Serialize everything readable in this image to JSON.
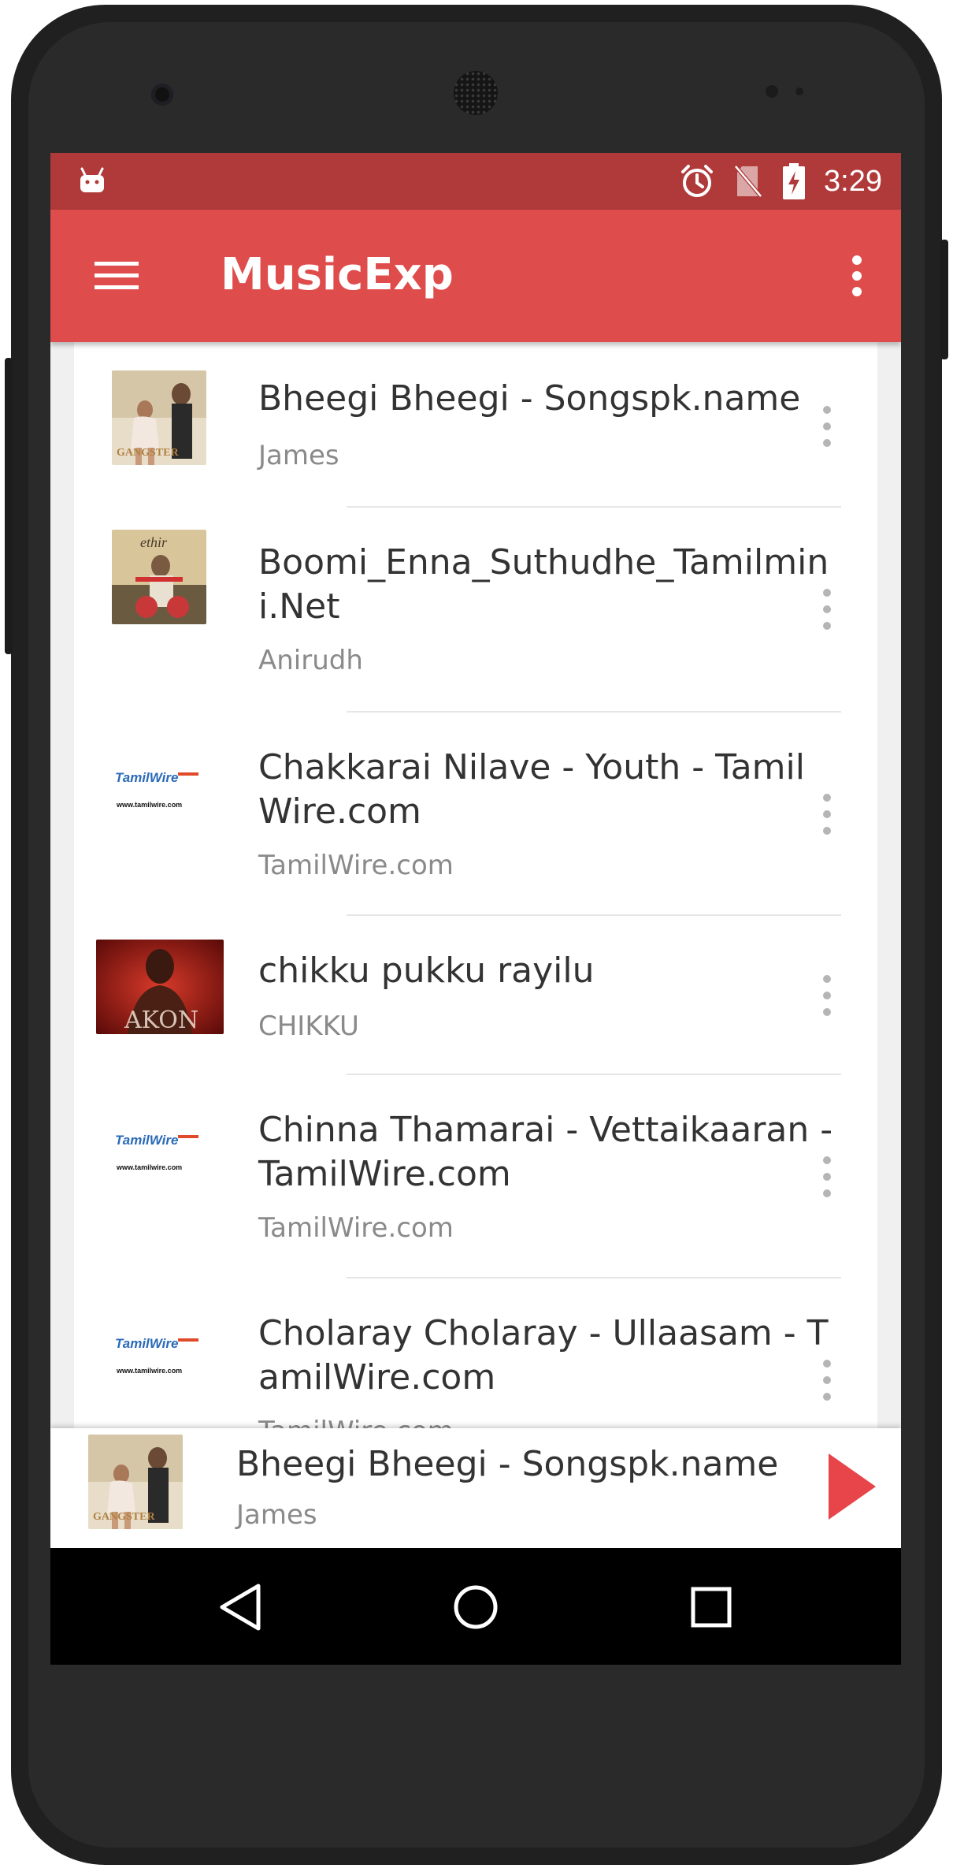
{
  "status_bar": {
    "time": "3:29",
    "icons": [
      "android-debug-icon",
      "alarm-icon",
      "no-sim-icon",
      "battery-charging-icon"
    ]
  },
  "app_bar": {
    "title": "MusicExp",
    "menu_icon": "hamburger-menu-icon",
    "overflow_icon": "more-vert-icon"
  },
  "songs": [
    {
      "title": "Bheegi Bheegi - Songspk.name",
      "artist": "James",
      "art": "gangster-album-art"
    },
    {
      "title": "Boomi_Enna_Suthudhe_Tamilmini.Net",
      "artist": "Anirudh",
      "art": "ethir-neechal-album-art"
    },
    {
      "title": "Chakkarai Nilave - Youth - TamilWire.com",
      "artist": "TamilWire.com",
      "art": "tamilwire-logo"
    },
    {
      "title": "chikku pukku rayilu",
      "artist": "CHIKKU",
      "art": "akon-album-art"
    },
    {
      "title": "Chinna Thamarai  - Vettaikaaran - TamilWire.com",
      "artist": "TamilWire.com",
      "art": "tamilwire-logo"
    },
    {
      "title": "Cholaray Cholaray - Ullaasam - TamilWire.com",
      "artist": "TamilWire.com",
      "art": "tamilwire-logo"
    }
  ],
  "tamilwire_logo": {
    "brand": "TamilWire",
    "url": "www.tamilwire.com"
  },
  "album_lettering": {
    "gangster": "GANGSTER",
    "akon": "AKON"
  },
  "now_playing": {
    "title": "Bheegi Bheegi - Songspk.name",
    "artist": "James",
    "control_icon": "play-icon"
  },
  "nav_bar": {
    "buttons": [
      "back-icon",
      "home-icon",
      "recents-icon"
    ]
  },
  "colors": {
    "status_bar": "#b03a3a",
    "app_bar": "#df4c4c",
    "accent_play": "#e8454a",
    "title_text": "#333333",
    "subtitle_text": "#8a8a8a"
  }
}
